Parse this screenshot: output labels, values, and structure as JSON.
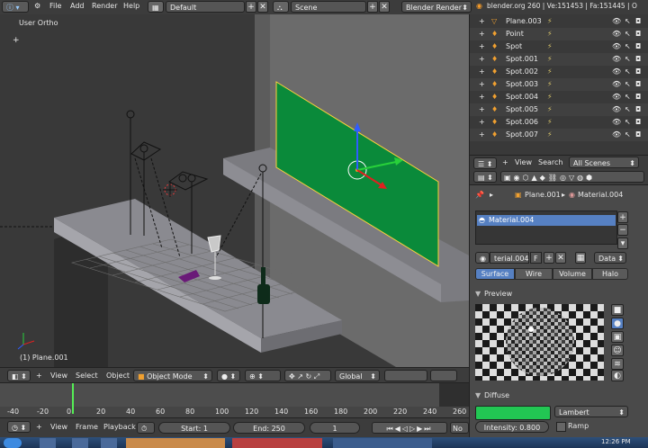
{
  "topbar": {
    "menus": [
      "File",
      "Add",
      "Render",
      "Help"
    ],
    "screen_layout": "Default",
    "scene": "Scene",
    "render_engine": "Blender Render",
    "stats": "blender.org 260 | Ve:151453 | Fa:151445 | O"
  },
  "viewport": {
    "view_name": "User Ortho",
    "object_label": "(1) Plane.001"
  },
  "viewport_header": {
    "view": "View",
    "select": "Select",
    "object": "Object",
    "mode": "Object Mode",
    "orientation": "Global"
  },
  "outliner": {
    "view": "View",
    "search": "Search",
    "filter": "All Scenes",
    "items": [
      {
        "label": "Plane.003"
      },
      {
        "label": "Point"
      },
      {
        "label": "Spot"
      },
      {
        "label": "Spot.001"
      },
      {
        "label": "Spot.002"
      },
      {
        "label": "Spot.003"
      },
      {
        "label": "Spot.004"
      },
      {
        "label": "Spot.005"
      },
      {
        "label": "Spot.006"
      },
      {
        "label": "Spot.007"
      }
    ]
  },
  "properties": {
    "breadcrumb_object": "Plane.001",
    "breadcrumb_material": "Material.004",
    "slot_name": "Material.004",
    "datablock_name": "terial.004",
    "datablock_flag": "F",
    "link_mode": "Data",
    "tabs": [
      "Surface",
      "Wire",
      "Volume",
      "Halo"
    ],
    "preview_title": "Preview",
    "diffuse_title": "Diffuse",
    "diffuse_shader": "Lambert",
    "intensity": "Intensity: 0.800",
    "ramp": "Ramp",
    "diffuse_color": "#22c653"
  },
  "timeline": {
    "ticks": [
      "-40",
      "-20",
      "0",
      "20",
      "40",
      "60",
      "80",
      "100",
      "120",
      "140",
      "160",
      "180",
      "200",
      "220",
      "240",
      "260"
    ],
    "view": "View",
    "frame": "Frame",
    "playback": "Playback",
    "start": "Start: 1",
    "end": "End: 250",
    "current": "1",
    "sync": "No S"
  },
  "taskbar": {
    "clock": "12:26 PM"
  }
}
